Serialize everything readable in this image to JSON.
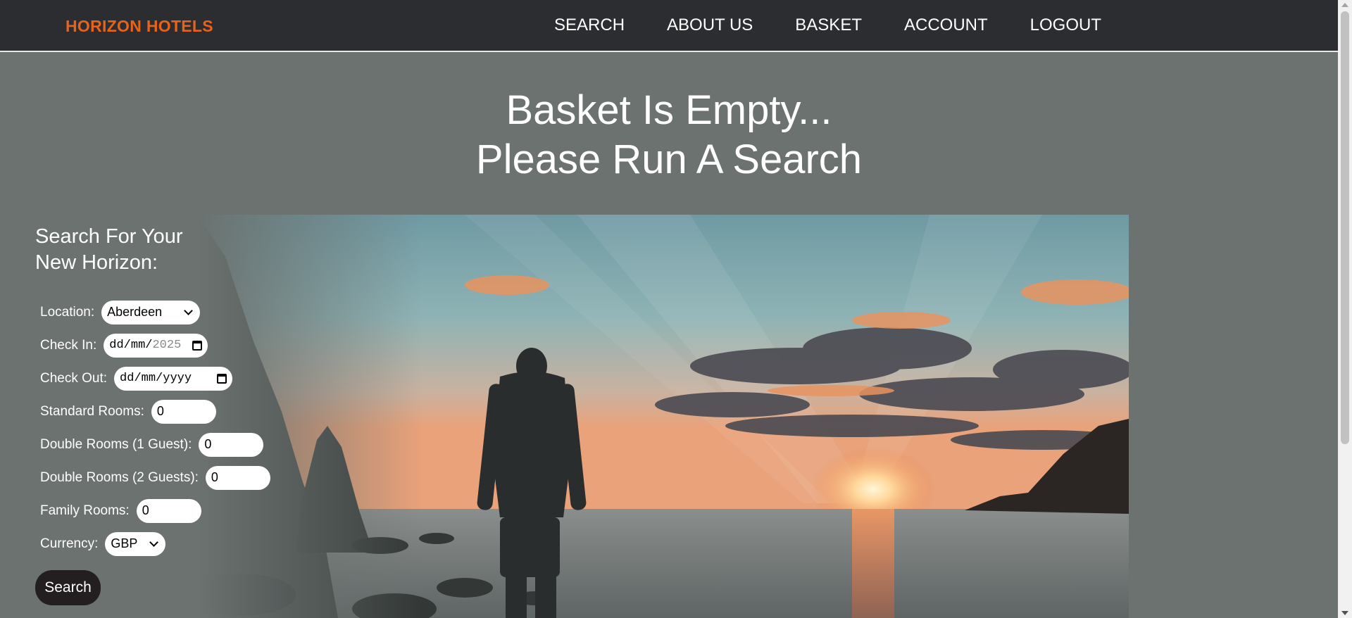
{
  "navbar": {
    "brand": "HORIZON HOTELS",
    "links": [
      "SEARCH",
      "ABOUT US",
      "BASKET",
      "ACCOUNT",
      "LOGOUT"
    ],
    "brand_color": "#e8631a",
    "background": "#2b2d31"
  },
  "hero": {
    "line1": "Basket Is Empty...",
    "line2": "Please Run A Search"
  },
  "search": {
    "heading_line1": "Search For Your",
    "heading_line2": "New Horizon:",
    "location_label": "Location:",
    "location_value": "Aberdeen",
    "checkin_label": "Check In:",
    "checkin_value_prefix": "dd/mm/",
    "checkin_value_year": "2025",
    "checkout_label": "Check Out:",
    "checkout_value": "dd/mm/yyyy",
    "standard_label": "Standard Rooms:",
    "standard_value": "0",
    "double1_label": "Double Rooms (1 Guest):",
    "double1_value": "0",
    "double2_label": "Double Rooms (2 Guests):",
    "double2_value": "0",
    "family_label": "Family Rooms:",
    "family_value": "0",
    "currency_label": "Currency:",
    "currency_value": "GBP",
    "button_label": "Search"
  },
  "icons": {
    "calendar": "calendar-icon",
    "dropdown": "chevron-down-icon"
  },
  "colors": {
    "page_background": "#6b7270",
    "button_background": "#231f20"
  }
}
